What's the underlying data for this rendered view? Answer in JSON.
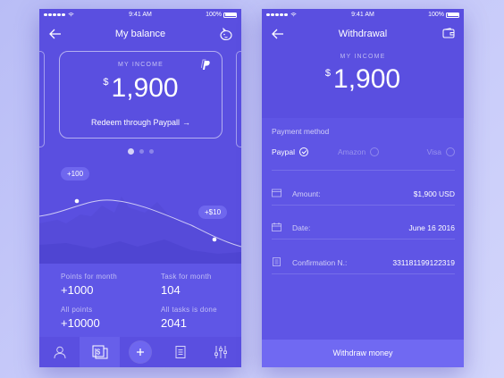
{
  "status": {
    "time": "9:41 AM",
    "battery": "100%"
  },
  "balance": {
    "title": "My balance",
    "card": {
      "label": "MY INCOME",
      "currency": "$",
      "amount": "1,900",
      "redeem": "Redeem through Paypall",
      "redeem_arrow": "→"
    },
    "chips": [
      "+100",
      "+$10"
    ],
    "stats": [
      {
        "label": "Points for month",
        "value": "+1000"
      },
      {
        "label": "Task for month",
        "value": "104"
      },
      {
        "label": "All points",
        "value": "+10000"
      },
      {
        "label": "All tasks is done",
        "value": "2041"
      }
    ],
    "tabs": [
      "profile-icon",
      "wallet-dollar-icon",
      "add-icon",
      "document-icon",
      "sliders-icon"
    ]
  },
  "withdrawal": {
    "title": "Withdrawal",
    "label": "MY INCOME",
    "currency": "$",
    "amount": "1,900",
    "section": "Payment method",
    "methods": [
      {
        "label": "Paypal",
        "selected": true
      },
      {
        "label": "Amazon",
        "selected": false
      },
      {
        "label": "Visa",
        "selected": false
      }
    ],
    "rows": [
      {
        "label": "Amount:",
        "value": "$1,900 USD",
        "icon": "card-icon"
      },
      {
        "label": "Date:",
        "value": "June 16 2016",
        "icon": "calendar-icon"
      },
      {
        "label": "Confirmation N.:",
        "value": "331181199122319",
        "icon": "receipt-icon"
      }
    ],
    "button": "Withdraw money"
  },
  "colors": {
    "bg": "#5a4fe0",
    "panel": "#5f56e6",
    "accent": "#7069f2"
  }
}
